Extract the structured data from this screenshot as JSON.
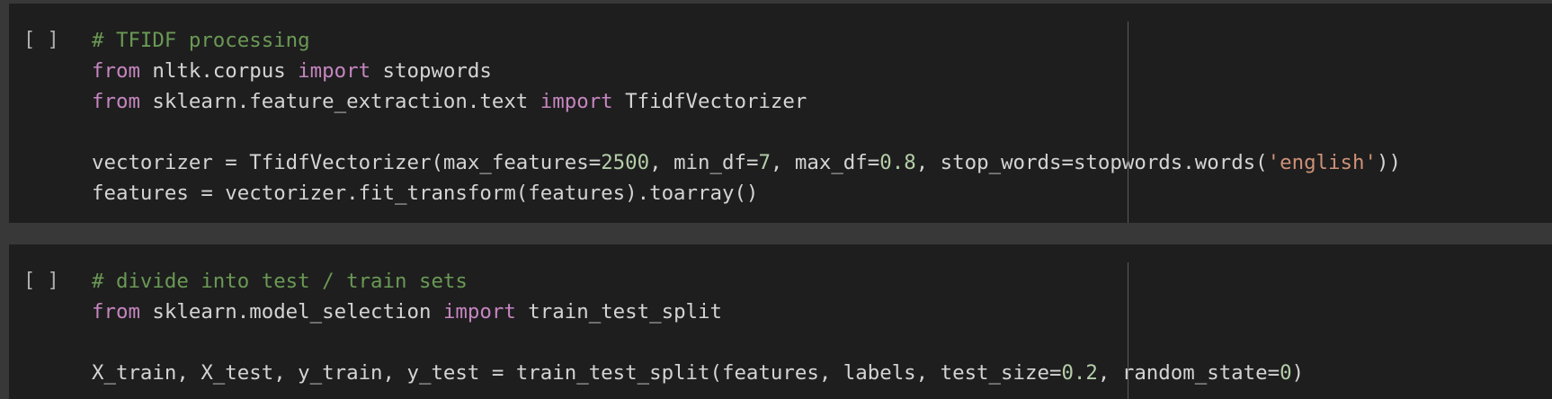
{
  "cells": [
    {
      "run_label": "[ ]",
      "lines": [
        [
          {
            "t": "# TFIDF processing",
            "c": "comment"
          }
        ],
        [
          {
            "t": "from",
            "c": "keyword"
          },
          {
            "t": " nltk.corpus ",
            "c": "plain"
          },
          {
            "t": "import",
            "c": "keyword"
          },
          {
            "t": " stopwords",
            "c": "plain"
          }
        ],
        [
          {
            "t": "from",
            "c": "keyword"
          },
          {
            "t": " sklearn.feature_extraction.text ",
            "c": "plain"
          },
          {
            "t": "import",
            "c": "keyword"
          },
          {
            "t": " TfidfVectorizer",
            "c": "plain"
          }
        ],
        [],
        [
          {
            "t": "vectorizer = TfidfVectorizer(max_features=",
            "c": "plain"
          },
          {
            "t": "2500",
            "c": "number"
          },
          {
            "t": ", min_df=",
            "c": "plain"
          },
          {
            "t": "7",
            "c": "number"
          },
          {
            "t": ", max_df=",
            "c": "plain"
          },
          {
            "t": "0.8",
            "c": "number"
          },
          {
            "t": ", stop_words=stopwords.words(",
            "c": "plain"
          },
          {
            "t": "'english'",
            "c": "string"
          },
          {
            "t": "))",
            "c": "plain"
          }
        ],
        [
          {
            "t": "features = vectorizer.fit_transform(features).toarray()",
            "c": "plain"
          }
        ]
      ]
    },
    {
      "run_label": "[ ]",
      "lines": [
        [
          {
            "t": "# divide into test / train sets",
            "c": "comment"
          }
        ],
        [
          {
            "t": "from",
            "c": "keyword"
          },
          {
            "t": " sklearn.model_selection ",
            "c": "plain"
          },
          {
            "t": "import",
            "c": "keyword"
          },
          {
            "t": " train_test_split",
            "c": "plain"
          }
        ],
        [],
        [
          {
            "t": "X_train, X_test, y_train, y_test = train_test_split(features, labels, test_size=",
            "c": "plain"
          },
          {
            "t": "0.2",
            "c": "number"
          },
          {
            "t": ", random_state=",
            "c": "plain"
          },
          {
            "t": "0",
            "c": "number"
          },
          {
            "t": ")",
            "c": "plain"
          }
        ]
      ]
    }
  ]
}
